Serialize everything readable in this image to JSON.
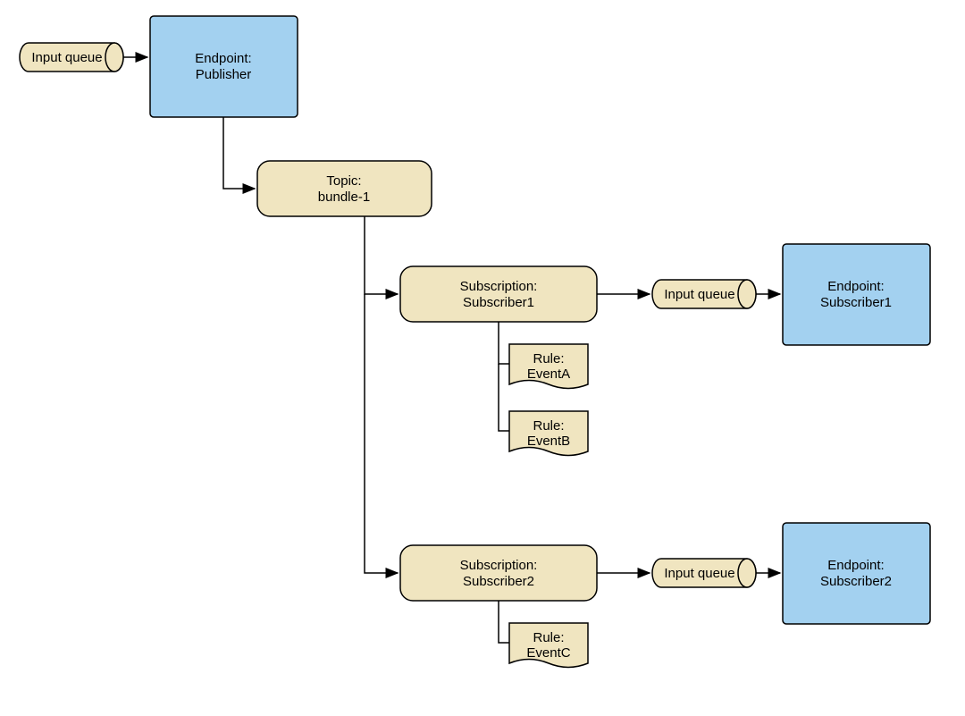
{
  "nodes": {
    "queue_publisher": {
      "label": "Input queue"
    },
    "endpoint_publisher": {
      "line1": "Endpoint:",
      "line2": "Publisher"
    },
    "topic": {
      "line1": "Topic:",
      "line2": "bundle-1"
    },
    "subscription1": {
      "line1": "Subscription:",
      "line2": "Subscriber1"
    },
    "rule_a": {
      "line1": "Rule:",
      "line2": "EventA"
    },
    "rule_b": {
      "line1": "Rule:",
      "line2": "EventB"
    },
    "queue_sub1": {
      "label": "Input queue"
    },
    "endpoint_sub1": {
      "line1": "Endpoint:",
      "line2": "Subscriber1"
    },
    "subscription2": {
      "line1": "Subscription:",
      "line2": "Subscriber2"
    },
    "rule_c": {
      "line1": "Rule:",
      "line2": "EventC"
    },
    "queue_sub2": {
      "label": "Input queue"
    },
    "endpoint_sub2": {
      "line1": "Endpoint:",
      "line2": "Subscriber2"
    }
  },
  "colors": {
    "endpoint_fill": "#a3d1f0",
    "beige_fill": "#f0e5c0",
    "stroke": "#000000"
  }
}
